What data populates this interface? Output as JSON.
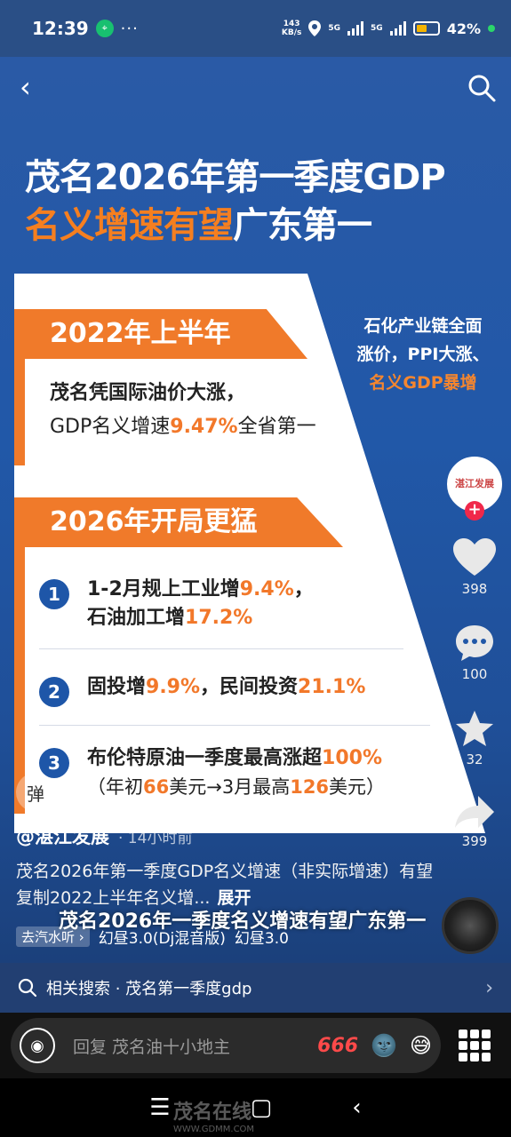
{
  "status": {
    "time": "12:39",
    "dots": "···",
    "net_speed_top": "143",
    "net_speed_bottom": "KB/s",
    "sim1": "5G",
    "sim2": "5G",
    "battery": "42%"
  },
  "video": {
    "headline_line1": "茂名2026年第一季度GDP",
    "headline_line2_orange": "名义增速有望",
    "headline_line2_white": "广东第一",
    "section1_title": "2022年上半年",
    "section1_line1": "茂名凭国际油价大涨，",
    "section1_line2_pre": "GDP名义增速",
    "section1_line2_num": "9.47%",
    "section1_line2_post": "全省第一",
    "side_line1": "石化产业链全面",
    "side_line2": "涨价，PPI大涨、",
    "side_line3": "名义GDP暴增",
    "section2_title": "2026年开局更猛",
    "items": [
      {
        "num": "1",
        "a_pre": "1-2月规上工业增",
        "a_num": "9.4%",
        "a_post": "，",
        "b_pre": "石油加工增",
        "b_num": "17.2%",
        "b_post": ""
      },
      {
        "num": "2",
        "a_pre": "固投增",
        "a_num": "9.9%",
        "a_post": "，民间投资",
        "a_num2": "21.1%"
      },
      {
        "num": "3",
        "a_pre": "布伦特原油一季度最高涨超",
        "a_num": "100%",
        "b_pre": "（年初",
        "b_num": "66",
        "b_mid": "美元→3月最高",
        "b_num2": "126",
        "b_post": "美元）"
      }
    ]
  },
  "rail": {
    "avatar_text": "湛江发展",
    "follow": "+",
    "likes": "398",
    "comments": "100",
    "favorites": "32",
    "shares": "399"
  },
  "danmu": "弹",
  "author": {
    "name": "@湛江发展",
    "time": "· 14小时前"
  },
  "description": {
    "text": "茂名2026年第一季度GDP名义增速（非实际增速）有望复制2022上半年名义增...",
    "expand": "展开"
  },
  "overlay_title": "茂名2026年一季度名义增速有望广东第一",
  "music": {
    "tag": "去汽水听 ›",
    "track": "幻昼3.0(Dj混音版)",
    "track2": "幻昼3.0"
  },
  "related": {
    "label": "相关搜索 · 茂名第一季度gdp"
  },
  "comment": {
    "placeholder": "回复 茂名油十小地主",
    "emoji_666": "666"
  },
  "watermark": {
    "brand": "茂名在线",
    "url": "WWW.GDMM.COM"
  },
  "colors": {
    "accent_orange": "#f07a2a",
    "blue_bg": "#2158a8",
    "like_red": "#f0284a"
  }
}
